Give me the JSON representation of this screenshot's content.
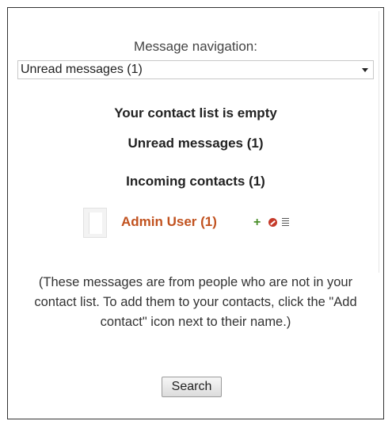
{
  "navigation": {
    "label": "Message navigation:",
    "selected": "Unread messages (1)"
  },
  "contacts": {
    "empty_text": "Your contact list is empty"
  },
  "unread": {
    "heading": "Unread messages (1)"
  },
  "incoming": {
    "heading": "Incoming contacts (1)",
    "contact": {
      "name": "Admin User (1)",
      "icons": [
        "add-contact-icon",
        "block-contact-icon",
        "message-history-icon"
      ]
    }
  },
  "info": {
    "text": "(These messages are from people who are not in your contact list. To add them to your contacts, click the \"Add contact\" icon next to their name.)"
  },
  "search": {
    "button_label": "Search"
  },
  "colors": {
    "contact_link": "#c1521f",
    "add_icon": "#4a8f2a",
    "block_icon": "#c53a2a"
  }
}
